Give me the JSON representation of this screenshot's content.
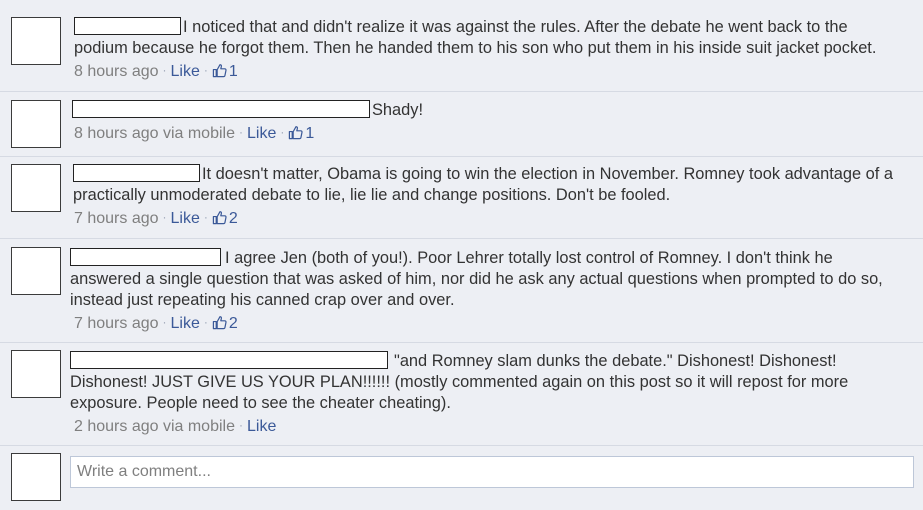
{
  "comments": [
    {
      "text": "I noticed that and didn't realize it was against the rules. After the debate he went back to the podium because he forgot them. Then he handed them to his son who put them in his inside suit jacket pocket.",
      "time": "8 hours ago",
      "via": "",
      "like_label": "Like",
      "likes": "1"
    },
    {
      "text": "Shady!",
      "time": "8 hours ago via mobile",
      "via": "",
      "like_label": "Like",
      "likes": "1"
    },
    {
      "text": "It doesn't matter, Obama is going to win the election in November. Romney took advantage of a practically unmoderated debate to lie, lie lie and change positions. Don't be fooled.",
      "time": "7 hours ago",
      "via": "",
      "like_label": "Like",
      "likes": "2"
    },
    {
      "text": "I agree Jen (both of you!). Poor Lehrer totally lost control of Romney. I don't think he answered a single question that was asked of him, nor did he ask any actual questions when prompted to do so, instead just repeating his canned crap over and over.",
      "time": "7 hours ago",
      "via": "",
      "like_label": "Like",
      "likes": "2"
    },
    {
      "text": "\"and Romney slam dunks the debate.\" Dishonest! Dishonest! Dishonest! JUST GIVE US YOUR PLAN!!!!!! (mostly commented again on this post so it will repost for more exposure. People need to see the cheater cheating).",
      "time": "2 hours ago via mobile",
      "via": "",
      "like_label": "Like",
      "likes": ""
    }
  ],
  "composer": {
    "placeholder": "Write a comment..."
  },
  "colors": {
    "link": "#3b5998",
    "meta": "#7f7f7f",
    "background": "#edeff4"
  },
  "icons": {
    "like_count": "thumbs-up-icon"
  }
}
